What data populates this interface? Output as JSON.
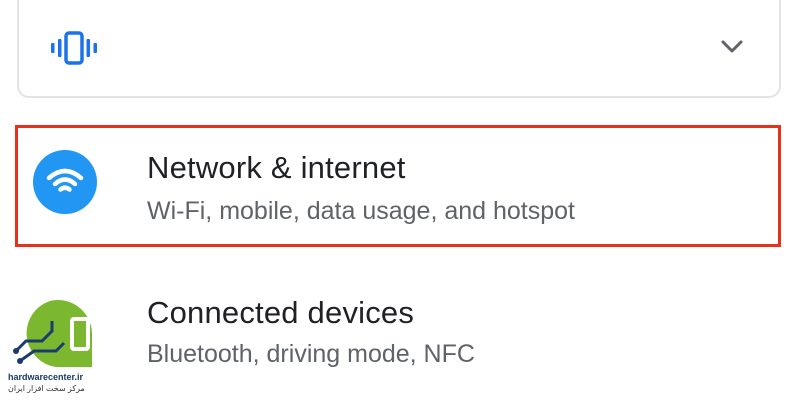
{
  "sound_card": {
    "icon": "vibrate-icon",
    "chevron": "chevron-down-icon",
    "accent": "#1a73e8"
  },
  "items": [
    {
      "title": "Network & internet",
      "subtitle": "Wi-Fi, mobile, data usage, and hotspot",
      "icon": "wifi-icon",
      "icon_bg": "#2196f3",
      "highlighted": true,
      "highlight_color": "#e8311a"
    },
    {
      "title": "Connected devices",
      "subtitle": "Bluetooth, driving mode, NFC",
      "icon": "devices-icon"
    }
  ],
  "watermark": {
    "domain": "hardwarecenter.ir",
    "tagline": "مرکز سخت افزار ایران"
  }
}
